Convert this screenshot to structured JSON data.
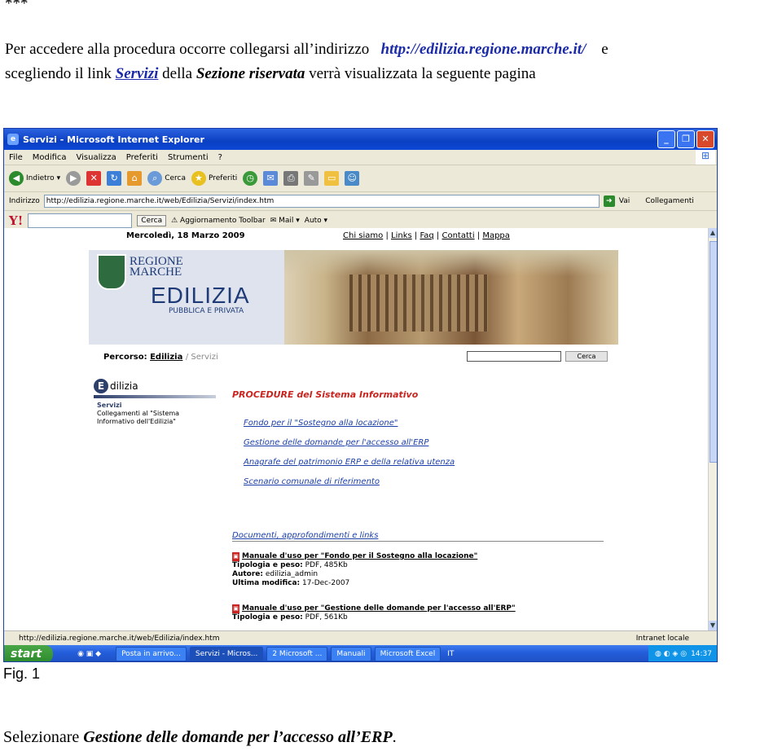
{
  "doc": {
    "stars": "***",
    "intro_a": "Per accedere alla procedura occorre collegarsi all’indirizzo",
    "intro_url": "http://edilizia.regione.marche.it/",
    "intro_e": "e",
    "line2_a": "scegliendo il link",
    "line2_link": "Servizi",
    "line2_b": "della",
    "line2_section": "Sezione riservata",
    "line2_c": "verrà visualizzata la seguente pagina",
    "caption": "Fig. 1",
    "final_a": "Selezionare",
    "final_b": "Gestione delle domande per l’accesso all’ERP",
    "final_c": "."
  },
  "window": {
    "title": "Servizi - Microsoft Internet Explorer",
    "menu": [
      "File",
      "Modifica",
      "Visualizza",
      "Preferiti",
      "Strumenti",
      "?"
    ],
    "toolbar": {
      "back": "Indietro",
      "search": "Cerca",
      "favorites": "Preferiti"
    },
    "address_label": "Indirizzo",
    "address_value": "http://edilizia.regione.marche.it/web/Edilizia/Servizi/index.htm",
    "go": "Vai",
    "links": "Collegamenti",
    "yahoo": {
      "logo": "Y!",
      "search": "Cerca",
      "update": "Aggiornamento Toolbar",
      "mail": "Mail",
      "auto": "Auto"
    },
    "status": "http://edilizia.regione.marche.it/web/Edilizia/index.htm",
    "zone": "Intranet locale",
    "taskbar": {
      "start": "start",
      "items": [
        "Posta in arrivo...",
        "Servizi - Micros...",
        "2 Microsoft ...",
        "Manuali",
        "Microsoft Excel"
      ],
      "lang": "IT",
      "clock": "14:37"
    }
  },
  "site": {
    "date": "Mercoledì, 18 Marzo 2009",
    "top_links": [
      "Chi siamo",
      "Links",
      "Faq",
      "Contatti",
      "Mappa"
    ],
    "regione_1": "REGIONE",
    "regione_2": "MARCHE",
    "brand": "EDILIZIA",
    "brand_sub": "PUBBLICA E PRIVATA",
    "crumb_label": "Percorso:",
    "crumb_link": "Edilizia",
    "crumb_current": "Servizi",
    "search_btn": "Cerca",
    "side_logo": "dilizia",
    "side_title": "Servizi",
    "side_line1": "Collegamenti al \"Sistema",
    "side_line2": "Informativo dell'Edilizia\"",
    "proc_title": "PROCEDURE del Sistema Informativo",
    "procedures": [
      "Fondo per il \"Sostegno alla locazione\"",
      "Gestione delle domande per l'accesso all'ERP",
      "Anagrafe del patrimonio ERP e della relativa utenza",
      "Scenario comunale di riferimento"
    ],
    "docs_title": "Documenti, approfondimenti e links",
    "docs": [
      {
        "name": "Manuale d'uso per \"Fondo per il Sostegno alla locazione\"",
        "tipo_label": "Tipologia e peso:",
        "tipo": "PDF, 485Kb",
        "autore_label": "Autore:",
        "autore": "edilizia_admin",
        "modifica_label": "Ultima modifica:",
        "modifica": "17-Dec-2007"
      },
      {
        "name": "Manuale d'uso per \"Gestione delle domande per l'accesso all'ERP\"",
        "tipo_label": "Tipologia e peso:",
        "tipo": "PDF, 561Kb"
      }
    ]
  }
}
